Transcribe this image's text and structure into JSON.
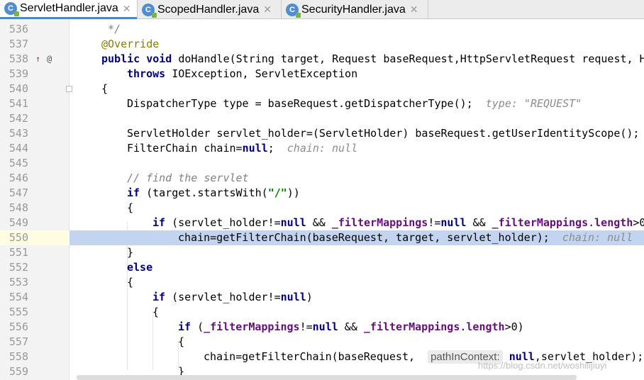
{
  "tabs": [
    {
      "label": "ServletHandler.java",
      "active": true
    },
    {
      "label": "ScopedHandler.java",
      "active": false
    },
    {
      "label": "SecurityHandler.java",
      "active": false
    }
  ],
  "tab_icon_letter": "C",
  "close_glyph": "✕",
  "line_numbers": [
    "536",
    "537",
    "538",
    "539",
    "540",
    "541",
    "542",
    "543",
    "544",
    "545",
    "546",
    "547",
    "548",
    "549",
    "550",
    "551",
    "552",
    "553",
    "554",
    "555",
    "556",
    "557",
    "558",
    "559"
  ],
  "highlighted_line": "550",
  "hints": {
    "type_hint": "type: \"REQUEST\"",
    "chain_hint": "chain: null",
    "chain_hint2": "chain: null",
    "param_hint": "pathInContext:"
  },
  "gutter_icons": {
    "override_up": "↑",
    "override_at": "@"
  },
  "watermark": "https://blog.csdn.net/woshilijiuyi",
  "colors": {
    "keyword": "#000080",
    "annotation": "#808000",
    "string": "#008000",
    "field": "#660e7a",
    "highlight": "#c3d4f0"
  }
}
